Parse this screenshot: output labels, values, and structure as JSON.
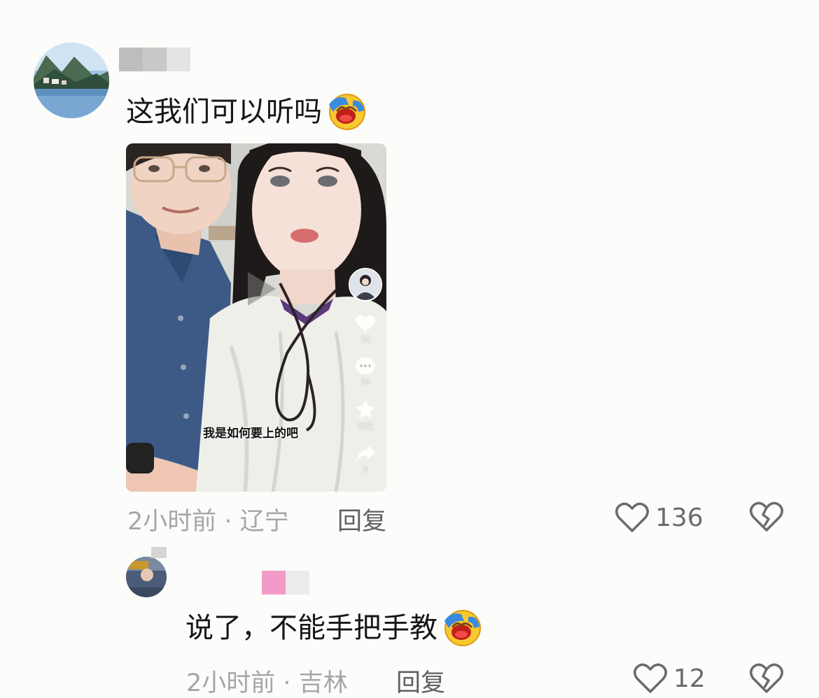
{
  "comments": [
    {
      "text": "这我们可以听吗",
      "emoji": "laugh-cry-emoji",
      "video": {
        "subtitle": "我是如何要上的吧",
        "rail": {
          "like_count": "38",
          "comment_count": "30",
          "collect_label": "收藏",
          "share_count": "6"
        }
      },
      "time_location": "2小时前 · 辽宁",
      "reply_label": "回复",
      "like_count": "136"
    },
    {
      "text": "说了，不能手把手教",
      "emoji": "laugh-cry-emoji",
      "time_location": "2小时前 · 吉林",
      "reply_label": "回复",
      "like_count": "12"
    }
  ],
  "colors": {
    "background": "#fcfcfa",
    "text": "#161616",
    "meta": "#a6a6a6",
    "reply": "#5f5f5f",
    "icon": "#6b6b6b",
    "redacted_pink": "#f29ac8"
  }
}
